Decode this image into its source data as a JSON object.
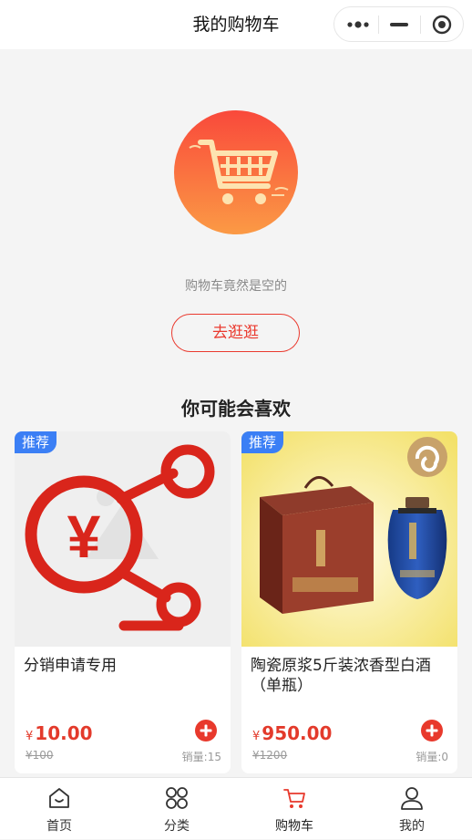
{
  "nav": {
    "title": "我的购物车"
  },
  "capsule": {
    "more_icon": "more-dots-icon",
    "min_icon": "minimize-icon",
    "close_icon": "target-circle-icon"
  },
  "empty": {
    "icon": "shopping-cart-icon",
    "text": "购物车竟然是空的",
    "button": "去逛逛"
  },
  "recommend": {
    "title": "你可能会喜欢",
    "items": [
      {
        "badge": "推荐",
        "name": "分销申请专用",
        "currency": "¥",
        "price": "10.00",
        "original_price": "¥100",
        "sales": "销量:15",
        "image": "distribution-share-icon"
      },
      {
        "badge": "推荐",
        "name": "陶瓷原浆5斤装浓香型白酒（单瓶）",
        "currency": "¥",
        "price": "950.00",
        "original_price": "¥1200",
        "sales": "销量:0",
        "image": "liquor-jar-and-gift-box"
      }
    ]
  },
  "tabbar": {
    "items": [
      {
        "label": "首页",
        "icon": "home-icon"
      },
      {
        "label": "分类",
        "icon": "category-grid-icon"
      },
      {
        "label": "购物车",
        "icon": "cart-icon",
        "active": true
      },
      {
        "label": "我的",
        "icon": "user-icon"
      }
    ]
  },
  "colors": {
    "accent": "#ea3a2f",
    "badge": "#3b7ff5",
    "background": "#f4f4f4"
  }
}
